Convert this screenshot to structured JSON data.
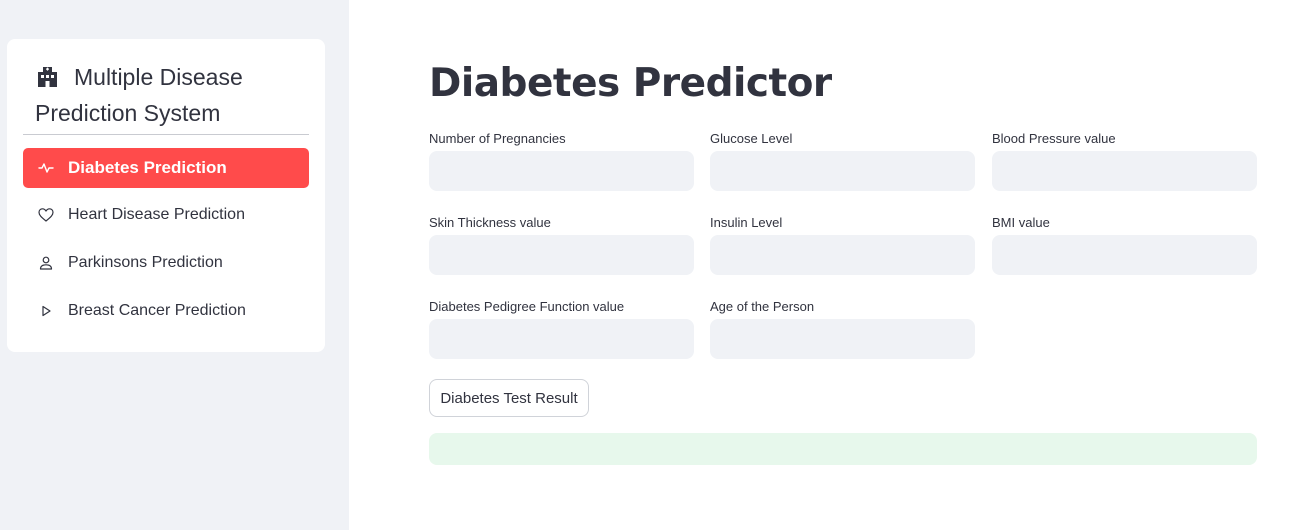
{
  "sidebar": {
    "menu_title": "Multiple Disease Prediction System",
    "title_icon": "hospital-icon",
    "items": [
      {
        "label": "Diabetes Prediction",
        "icon": "activity-icon",
        "active": true
      },
      {
        "label": "Heart Disease Prediction",
        "icon": "heart-icon",
        "active": false
      },
      {
        "label": "Parkinsons Prediction",
        "icon": "person-icon",
        "active": false
      },
      {
        "label": "Breast Cancer Prediction",
        "icon": "play-icon",
        "active": false
      }
    ]
  },
  "main": {
    "title": "Diabetes Predictor",
    "fields": [
      {
        "label": "Number of Pregnancies",
        "value": ""
      },
      {
        "label": "Glucose Level",
        "value": ""
      },
      {
        "label": "Blood Pressure value",
        "value": ""
      },
      {
        "label": "Skin Thickness value",
        "value": ""
      },
      {
        "label": "Insulin Level",
        "value": ""
      },
      {
        "label": "BMI value",
        "value": ""
      },
      {
        "label": "Diabetes Pedigree Function value",
        "value": ""
      },
      {
        "label": "Age of the Person",
        "value": ""
      }
    ],
    "button_label": "Diabetes Test Result",
    "result_text": ""
  },
  "colors": {
    "accent": "#ff4b4b",
    "sidebar_bg": "#f0f2f6",
    "input_bg": "#f0f2f6",
    "result_bg": "#e7f8ec",
    "text": "#31333f"
  }
}
